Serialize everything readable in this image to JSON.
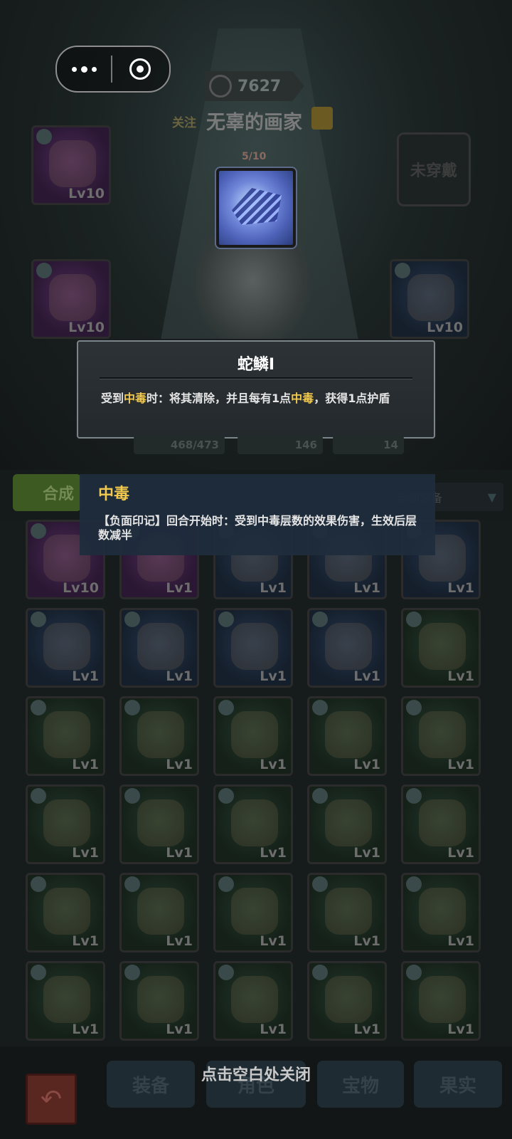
{
  "header": {
    "power": "7627",
    "follow_label": "关注",
    "player_name": "无辜的画家",
    "unworn_label": "未穿戴"
  },
  "equip_slots": [
    {
      "level": "Lv10",
      "rarity": "purple"
    },
    {
      "level": "Lv10",
      "rarity": "purple"
    },
    {
      "level": "Lv10",
      "rarity": "blue"
    }
  ],
  "relic": {
    "counter": "5/10",
    "icon": "snake-scale-icon"
  },
  "relic_tooltip": {
    "title": "蛇鳞I",
    "desc_part1": "受到",
    "desc_kw1": "中毒",
    "desc_part2": "时：将其清除，并且每有1点",
    "desc_kw2": "中毒",
    "desc_part3": "，获得1点护盾"
  },
  "stats": {
    "hp": "468/473",
    "attack": "146",
    "shield": "14"
  },
  "poison_tooltip": {
    "title": "中毒",
    "desc": "【负面印记】回合开始时：受到中毒层数的效果伤害，生效后层数减半"
  },
  "inventory": {
    "craft_label": "合成",
    "filter_label": "全部装备",
    "items": [
      {
        "level": "Lv10",
        "rarity": "purple"
      },
      {
        "level": "Lv1",
        "rarity": "purple"
      },
      {
        "level": "Lv1",
        "rarity": "blue"
      },
      {
        "level": "Lv1",
        "rarity": "blue"
      },
      {
        "level": "Lv1",
        "rarity": "blue"
      },
      {
        "level": "Lv1",
        "rarity": "blue"
      },
      {
        "level": "Lv1",
        "rarity": "blue"
      },
      {
        "level": "Lv1",
        "rarity": "blue"
      },
      {
        "level": "Lv1",
        "rarity": "blue"
      },
      {
        "level": "Lv1",
        "rarity": "green"
      },
      {
        "level": "Lv1",
        "rarity": "green"
      },
      {
        "level": "Lv1",
        "rarity": "green"
      },
      {
        "level": "Lv1",
        "rarity": "green"
      },
      {
        "level": "Lv1",
        "rarity": "green"
      },
      {
        "level": "Lv1",
        "rarity": "green"
      },
      {
        "level": "Lv1",
        "rarity": "green"
      },
      {
        "level": "Lv1",
        "rarity": "green"
      },
      {
        "level": "Lv1",
        "rarity": "green"
      },
      {
        "level": "Lv1",
        "rarity": "green"
      },
      {
        "level": "Lv1",
        "rarity": "green"
      },
      {
        "level": "Lv1",
        "rarity": "green"
      },
      {
        "level": "Lv1",
        "rarity": "green"
      },
      {
        "level": "Lv1",
        "rarity": "green"
      },
      {
        "level": "Lv1",
        "rarity": "green"
      },
      {
        "level": "Lv1",
        "rarity": "green"
      },
      {
        "level": "Lv1",
        "rarity": "green"
      },
      {
        "level": "Lv1",
        "rarity": "green"
      },
      {
        "level": "Lv1",
        "rarity": "green"
      },
      {
        "level": "Lv1",
        "rarity": "green"
      },
      {
        "level": "Lv1",
        "rarity": "green"
      }
    ]
  },
  "bottom_tabs": [
    "装备",
    "角色",
    "宝物",
    "果实"
  ],
  "close_hint": "点击空白处关闭"
}
